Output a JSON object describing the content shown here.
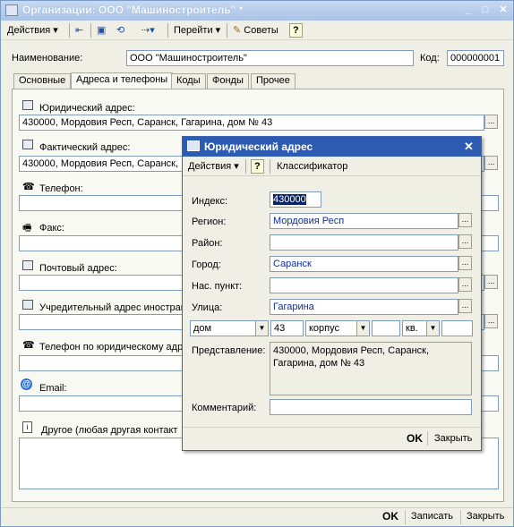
{
  "window": {
    "title": "Организации: ООО \"Машиностроитель\" *"
  },
  "toolbar": {
    "actions": "Действия",
    "goto": "Перейти",
    "tips": "Советы",
    "help": "?"
  },
  "header": {
    "name_label": "Наименование:",
    "name_value": "ООО \"Машиностроитель\"",
    "code_label": "Код:",
    "code_value": "000000001"
  },
  "tabs": [
    "Основные",
    "Адреса и телефоны",
    "Коды",
    "Фонды",
    "Прочее"
  ],
  "fields": {
    "legal_address_label": "Юридический адрес:",
    "legal_address_value": "430000, Мордовия Респ, Саранск, Гагарина, дом № 43",
    "actual_address_label": "Фактический адрес:",
    "actual_address_value": "430000, Мордовия Респ, Саранск, Гагарина, дом № 43",
    "phone_label": "Телефон:",
    "fax_label": "Факс:",
    "postal_label": "Почтовый адрес:",
    "founder_label": "Учредительный адрес иностран",
    "legal_phone_label": "Телефон по юридическому адре",
    "email_label": "Email:",
    "other_label": "Другое (любая другая контакт"
  },
  "footer": {
    "ok": "OK",
    "save": "Записать",
    "close": "Закрыть"
  },
  "dialog": {
    "title": "Юридический адрес",
    "actions": "Действия",
    "help": "?",
    "classifier": "Классификатор",
    "index_label": "Индекс:",
    "index_value": "430000",
    "region_label": "Регион:",
    "region_value": "Мордовия Респ",
    "district_label": "Район:",
    "district_value": "",
    "city_label": "Город:",
    "city_value": "Саранск",
    "settlement_label": "Нас. пункт:",
    "settlement_value": "",
    "street_label": "Улица:",
    "street_value": "Гагарина",
    "house_type": "дом",
    "house_value": "43",
    "building_type": "корпус",
    "building_value": "",
    "apt_type": "кв.",
    "apt_value": "",
    "presentation_label": "Представление:",
    "presentation_value": "430000, Мордовия Респ, Саранск, Гагарина, дом № 43",
    "comment_label": "Комментарий:",
    "comment_value": "",
    "ok": "OK",
    "close": "Закрыть"
  }
}
